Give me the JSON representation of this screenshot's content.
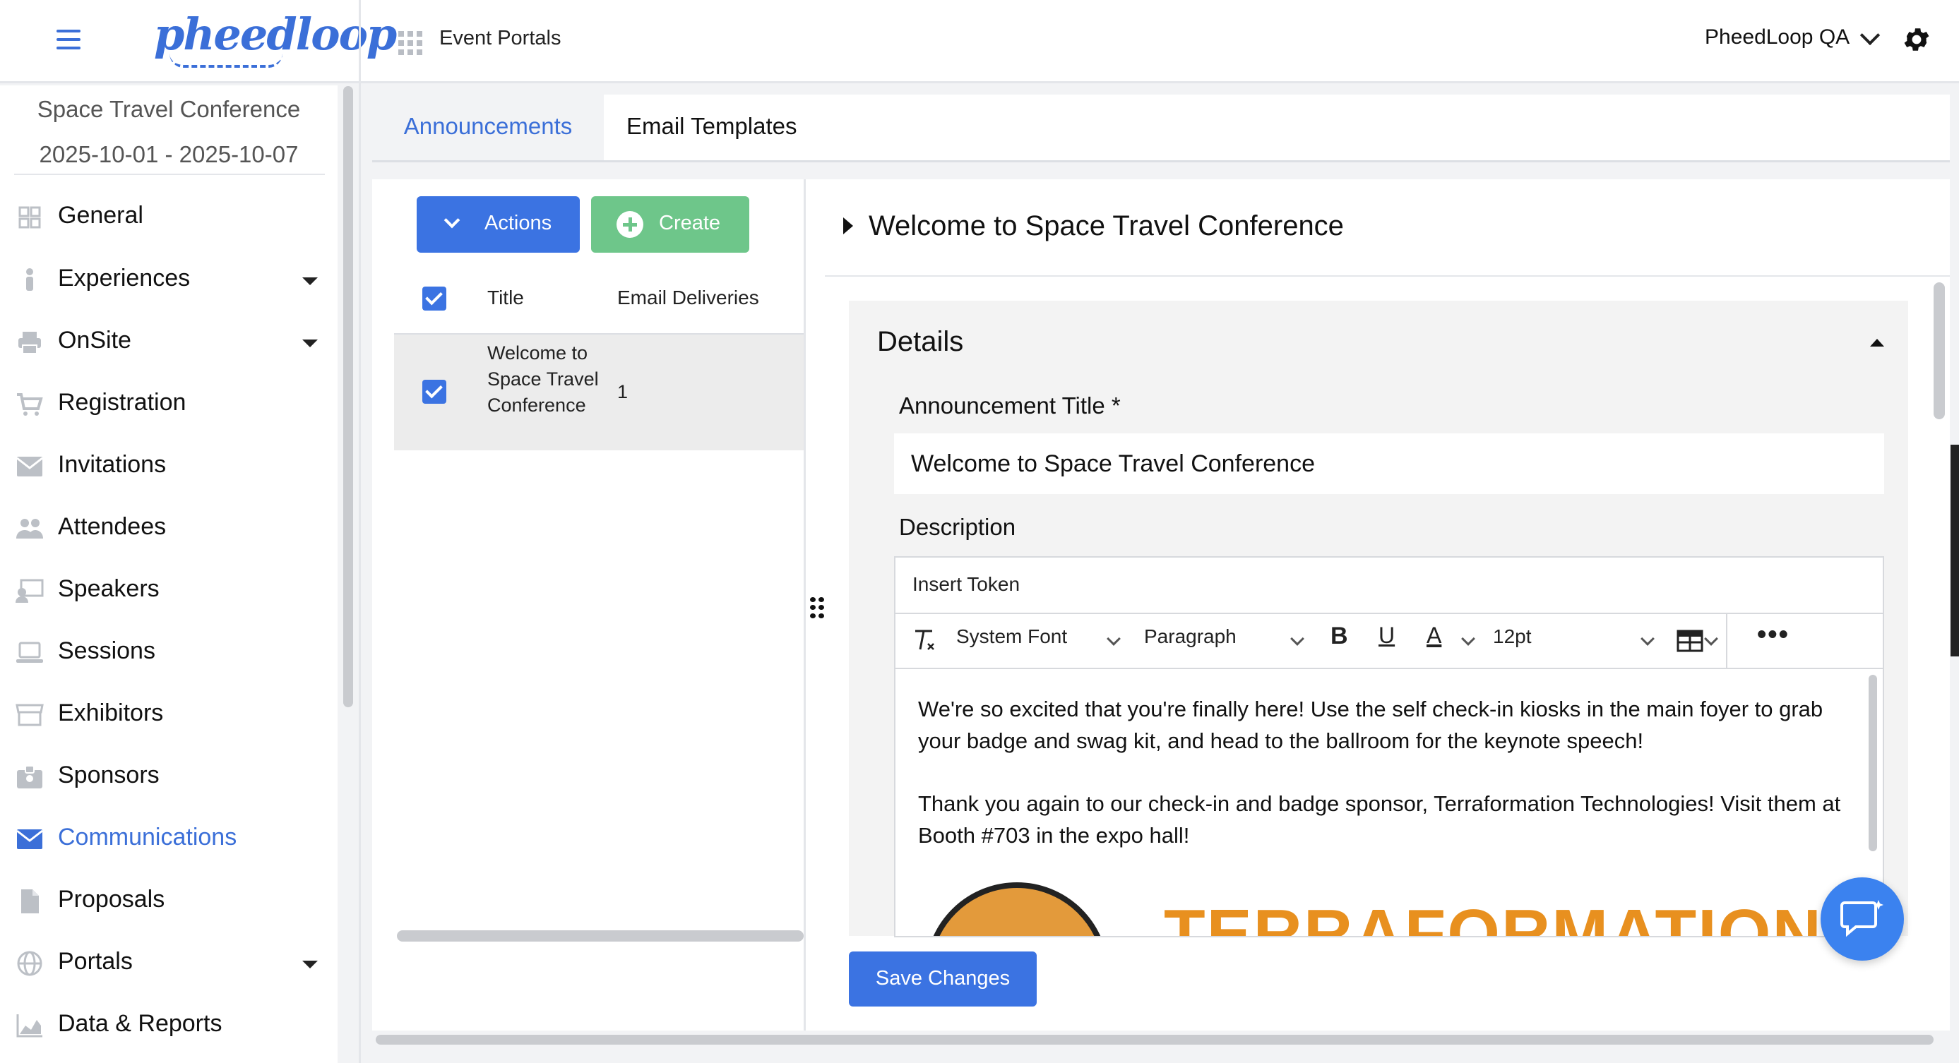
{
  "header": {
    "logo_text": "pheedloop",
    "portal_label": "Event Portals",
    "account_name": "PheedLoop QA"
  },
  "event": {
    "name": "Space Travel Conference",
    "dates": "2025-10-01 - 2025-10-07"
  },
  "sidebar": {
    "items": [
      {
        "label": "General",
        "icon": "grid-icon",
        "caret": false
      },
      {
        "label": "Experiences",
        "icon": "person-icon",
        "caret": true
      },
      {
        "label": "OnSite",
        "icon": "printer-icon",
        "caret": true
      },
      {
        "label": "Registration",
        "icon": "cart-icon",
        "caret": false
      },
      {
        "label": "Invitations",
        "icon": "envelope-icon",
        "caret": false
      },
      {
        "label": "Attendees",
        "icon": "people-icon",
        "caret": false
      },
      {
        "label": "Speakers",
        "icon": "speaker-icon",
        "caret": false
      },
      {
        "label": "Sessions",
        "icon": "laptop-icon",
        "caret": false
      },
      {
        "label": "Exhibitors",
        "icon": "store-icon",
        "caret": false
      },
      {
        "label": "Sponsors",
        "icon": "badge-icon",
        "caret": false
      },
      {
        "label": "Communications",
        "icon": "envelope-icon",
        "caret": false,
        "active": true
      },
      {
        "label": "Proposals",
        "icon": "document-icon",
        "caret": false
      },
      {
        "label": "Portals",
        "icon": "globe-icon",
        "caret": true
      },
      {
        "label": "Data & Reports",
        "icon": "chart-icon",
        "caret": false
      }
    ]
  },
  "tabs": {
    "announcements": "Announcements",
    "email_templates": "Email Templates"
  },
  "list": {
    "actions_label": "Actions",
    "create_label": "Create",
    "columns": {
      "title": "Title",
      "email_deliveries": "Email Deliveries"
    },
    "rows": [
      {
        "title": "Welcome to Space Travel Conference",
        "email_deliveries": "1",
        "checked": true
      }
    ]
  },
  "detail": {
    "title": "Welcome to Space Travel Conference",
    "section_title": "Details",
    "announcement_title_label": "Announcement Title *",
    "announcement_title_value": "Welcome to Space Travel Conference",
    "description_label": "Description",
    "insert_token_label": "Insert Token",
    "toolbar": {
      "font": "System Font",
      "block": "Paragraph",
      "size": "12pt"
    },
    "body_paragraph_1": "We're so excited that you're finally here! Use the self check-in kiosks in the main foyer to grab your badge and swag kit, and head to the ballroom for the keynote speech!",
    "body_paragraph_2": "Thank you again to our check-in and badge sponsor, Terraformation Technologies! Visit them at Booth #703 in the expo hall!",
    "sponsor_logo_text": "TERRAFORMATION",
    "save_label": "Save Changes"
  },
  "colors": {
    "accent": "#3b73e2",
    "create_green": "#6ec68a",
    "terra_orange": "#e8901f"
  }
}
